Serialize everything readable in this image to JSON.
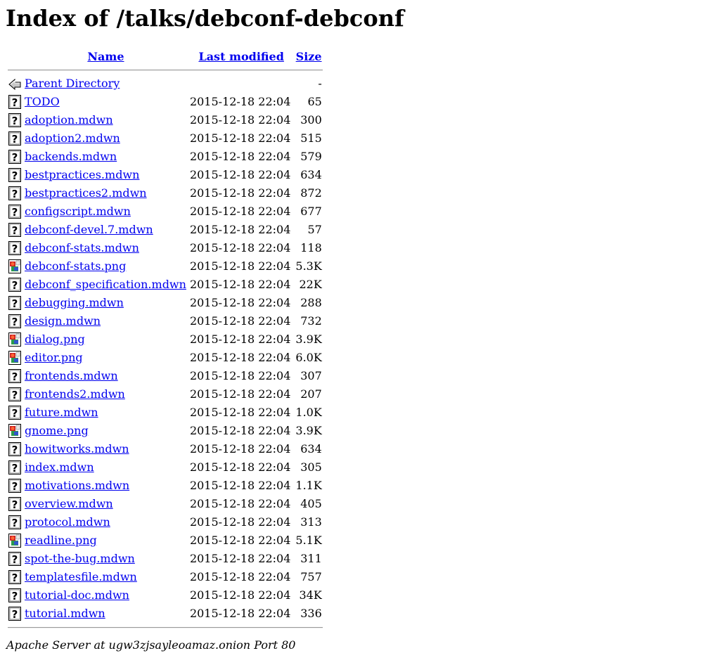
{
  "page": {
    "title": "Index of /talks/debconf-debconf"
  },
  "table": {
    "columns": {
      "name": "Name",
      "last_modified": "Last modified",
      "size": "Size"
    },
    "parent": {
      "label": "Parent Directory",
      "size": "-",
      "icon": "back-icon"
    },
    "rows": [
      {
        "name": "TODO",
        "modified": "2015-12-18 22:04",
        "size": "65",
        "icon": "unknown-file-icon"
      },
      {
        "name": "adoption.mdwn",
        "modified": "2015-12-18 22:04",
        "size": "300",
        "icon": "unknown-file-icon"
      },
      {
        "name": "adoption2.mdwn",
        "modified": "2015-12-18 22:04",
        "size": "515",
        "icon": "unknown-file-icon"
      },
      {
        "name": "backends.mdwn",
        "modified": "2015-12-18 22:04",
        "size": "579",
        "icon": "unknown-file-icon"
      },
      {
        "name": "bestpractices.mdwn",
        "modified": "2015-12-18 22:04",
        "size": "634",
        "icon": "unknown-file-icon"
      },
      {
        "name": "bestpractices2.mdwn",
        "modified": "2015-12-18 22:04",
        "size": "872",
        "icon": "unknown-file-icon"
      },
      {
        "name": "configscript.mdwn",
        "modified": "2015-12-18 22:04",
        "size": "677",
        "icon": "unknown-file-icon"
      },
      {
        "name": "debconf-devel.7.mdwn",
        "modified": "2015-12-18 22:04",
        "size": "57",
        "icon": "unknown-file-icon"
      },
      {
        "name": "debconf-stats.mdwn",
        "modified": "2015-12-18 22:04",
        "size": "118",
        "icon": "unknown-file-icon"
      },
      {
        "name": "debconf-stats.png",
        "modified": "2015-12-18 22:04",
        "size": "5.3K",
        "icon": "image-file-icon"
      },
      {
        "name": "debconf_specification.mdwn",
        "modified": "2015-12-18 22:04",
        "size": "22K",
        "icon": "unknown-file-icon"
      },
      {
        "name": "debugging.mdwn",
        "modified": "2015-12-18 22:04",
        "size": "288",
        "icon": "unknown-file-icon"
      },
      {
        "name": "design.mdwn",
        "modified": "2015-12-18 22:04",
        "size": "732",
        "icon": "unknown-file-icon"
      },
      {
        "name": "dialog.png",
        "modified": "2015-12-18 22:04",
        "size": "3.9K",
        "icon": "image-file-icon"
      },
      {
        "name": "editor.png",
        "modified": "2015-12-18 22:04",
        "size": "6.0K",
        "icon": "image-file-icon"
      },
      {
        "name": "frontends.mdwn",
        "modified": "2015-12-18 22:04",
        "size": "307",
        "icon": "unknown-file-icon"
      },
      {
        "name": "frontends2.mdwn",
        "modified": "2015-12-18 22:04",
        "size": "207",
        "icon": "unknown-file-icon"
      },
      {
        "name": "future.mdwn",
        "modified": "2015-12-18 22:04",
        "size": "1.0K",
        "icon": "unknown-file-icon"
      },
      {
        "name": "gnome.png",
        "modified": "2015-12-18 22:04",
        "size": "3.9K",
        "icon": "image-file-icon"
      },
      {
        "name": "howitworks.mdwn",
        "modified": "2015-12-18 22:04",
        "size": "634",
        "icon": "unknown-file-icon"
      },
      {
        "name": "index.mdwn",
        "modified": "2015-12-18 22:04",
        "size": "305",
        "icon": "unknown-file-icon"
      },
      {
        "name": "motivations.mdwn",
        "modified": "2015-12-18 22:04",
        "size": "1.1K",
        "icon": "unknown-file-icon"
      },
      {
        "name": "overview.mdwn",
        "modified": "2015-12-18 22:04",
        "size": "405",
        "icon": "unknown-file-icon"
      },
      {
        "name": "protocol.mdwn",
        "modified": "2015-12-18 22:04",
        "size": "313",
        "icon": "unknown-file-icon"
      },
      {
        "name": "readline.png",
        "modified": "2015-12-18 22:04",
        "size": "5.1K",
        "icon": "image-file-icon"
      },
      {
        "name": "spot-the-bug.mdwn",
        "modified": "2015-12-18 22:04",
        "size": "311",
        "icon": "unknown-file-icon"
      },
      {
        "name": "templatesfile.mdwn",
        "modified": "2015-12-18 22:04",
        "size": "757",
        "icon": "unknown-file-icon"
      },
      {
        "name": "tutorial-doc.mdwn",
        "modified": "2015-12-18 22:04",
        "size": "34K",
        "icon": "unknown-file-icon"
      },
      {
        "name": "tutorial.mdwn",
        "modified": "2015-12-18 22:04",
        "size": "336",
        "icon": "unknown-file-icon"
      }
    ]
  },
  "footer": {
    "address": "Apache Server at ugw3zjsayleoamaz.onion Port 80"
  },
  "colors": {
    "link": "#0000ee",
    "rule": "#9a9a9a"
  }
}
